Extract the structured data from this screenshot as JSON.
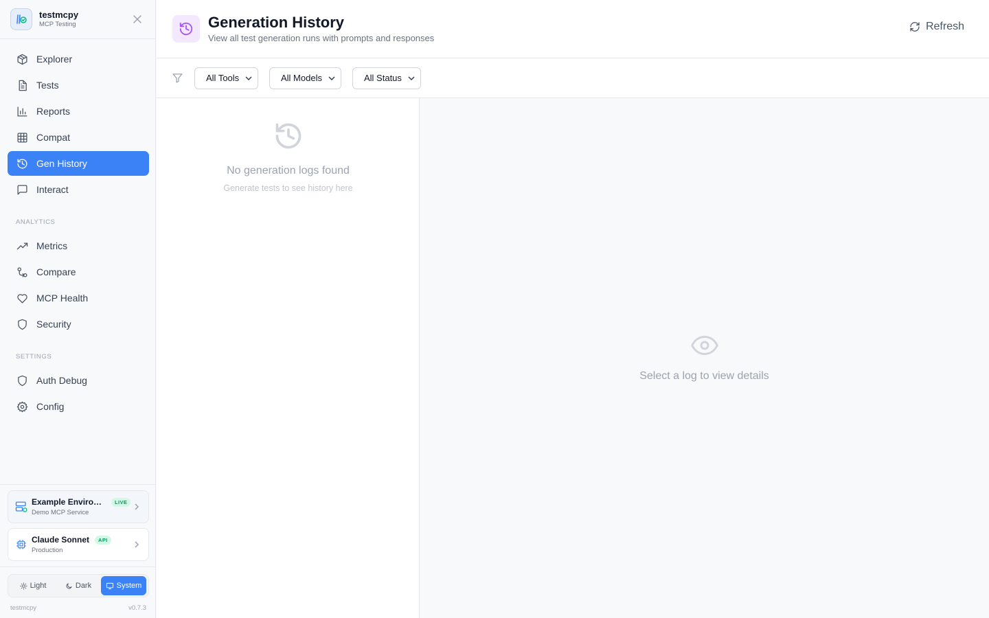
{
  "brand": {
    "name": "testmcpy",
    "subtitle": "MCP Testing",
    "logo_icon": "flask-check-icon"
  },
  "nav": {
    "main": [
      {
        "label": "Explorer",
        "icon": "cube-icon"
      },
      {
        "label": "Tests",
        "icon": "file-text-icon"
      },
      {
        "label": "Reports",
        "icon": "bar-chart-icon"
      },
      {
        "label": "Compat",
        "icon": "grid-icon"
      },
      {
        "label": "Gen History",
        "icon": "history-icon",
        "active": true
      },
      {
        "label": "Interact",
        "icon": "message-square-icon"
      }
    ],
    "analytics_heading": "ANALYTICS",
    "analytics": [
      {
        "label": "Metrics",
        "icon": "trending-up-icon"
      },
      {
        "label": "Compare",
        "icon": "git-compare-icon"
      },
      {
        "label": "MCP Health",
        "icon": "heart-icon"
      },
      {
        "label": "Security",
        "icon": "shield-icon"
      }
    ],
    "settings_heading": "SETTINGS",
    "settings": [
      {
        "label": "Auth Debug",
        "icon": "shield-icon"
      },
      {
        "label": "Config",
        "icon": "gear-icon"
      }
    ]
  },
  "environment": {
    "title": "Example Environm...",
    "badge": "LIVE",
    "subtitle": "Demo MCP Service"
  },
  "model": {
    "title": "Claude Sonnet",
    "badge": "API",
    "subtitle": "Production"
  },
  "theme": {
    "light": "Light",
    "dark": "Dark",
    "system": "System",
    "selected": "System"
  },
  "footer": {
    "app": "testmcpy",
    "version": "v0.7.3"
  },
  "header": {
    "title": "Generation History",
    "subtitle": "View all test generation runs with prompts and responses",
    "refresh_label": "Refresh"
  },
  "filters": {
    "tools": "All Tools",
    "models": "All Models",
    "status": "All Status"
  },
  "list": {
    "empty_title": "No generation logs found",
    "empty_subtitle": "Generate tests to see history here"
  },
  "detail": {
    "empty_message": "Select a log to view details"
  },
  "colors": {
    "accent": "#3b82f6",
    "header_icon_bg": "#f3e8ff",
    "header_icon": "#a855f7",
    "live_badge": "#059669"
  }
}
